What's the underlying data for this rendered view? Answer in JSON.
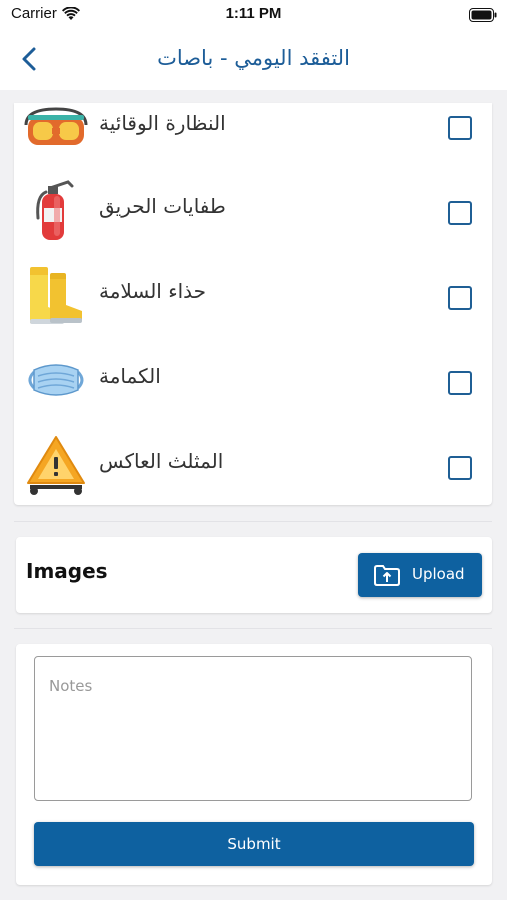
{
  "status_bar": {
    "carrier": "Carrier",
    "time": "1:11 PM"
  },
  "nav": {
    "title": "التفقد اليومي - باصات",
    "back_icon": "chevron-left-icon"
  },
  "checklist": {
    "items": [
      {
        "label": "النظارة الوقائية",
        "icon": "safety-goggles-icon",
        "checked": false
      },
      {
        "label": "طفايات الحريق",
        "icon": "fire-extinguisher-icon",
        "checked": false
      },
      {
        "label": "حذاء السلامة",
        "icon": "safety-boots-icon",
        "checked": false
      },
      {
        "label": "الكمامة",
        "icon": "face-mask-icon",
        "checked": false
      },
      {
        "label": "المثلث العاكس",
        "icon": "warning-triangle-icon",
        "checked": false
      }
    ]
  },
  "images_section": {
    "title": "Images",
    "upload_label": "Upload",
    "upload_icon": "folder-upload-icon"
  },
  "notes_section": {
    "notes_placeholder": "Notes",
    "notes_value": "",
    "submit_label": "Submit"
  },
  "colors": {
    "primary": "#0e61a0",
    "title": "#1d5d98",
    "checkbox_border": "#1f5f95",
    "background": "#f1f1f3"
  }
}
